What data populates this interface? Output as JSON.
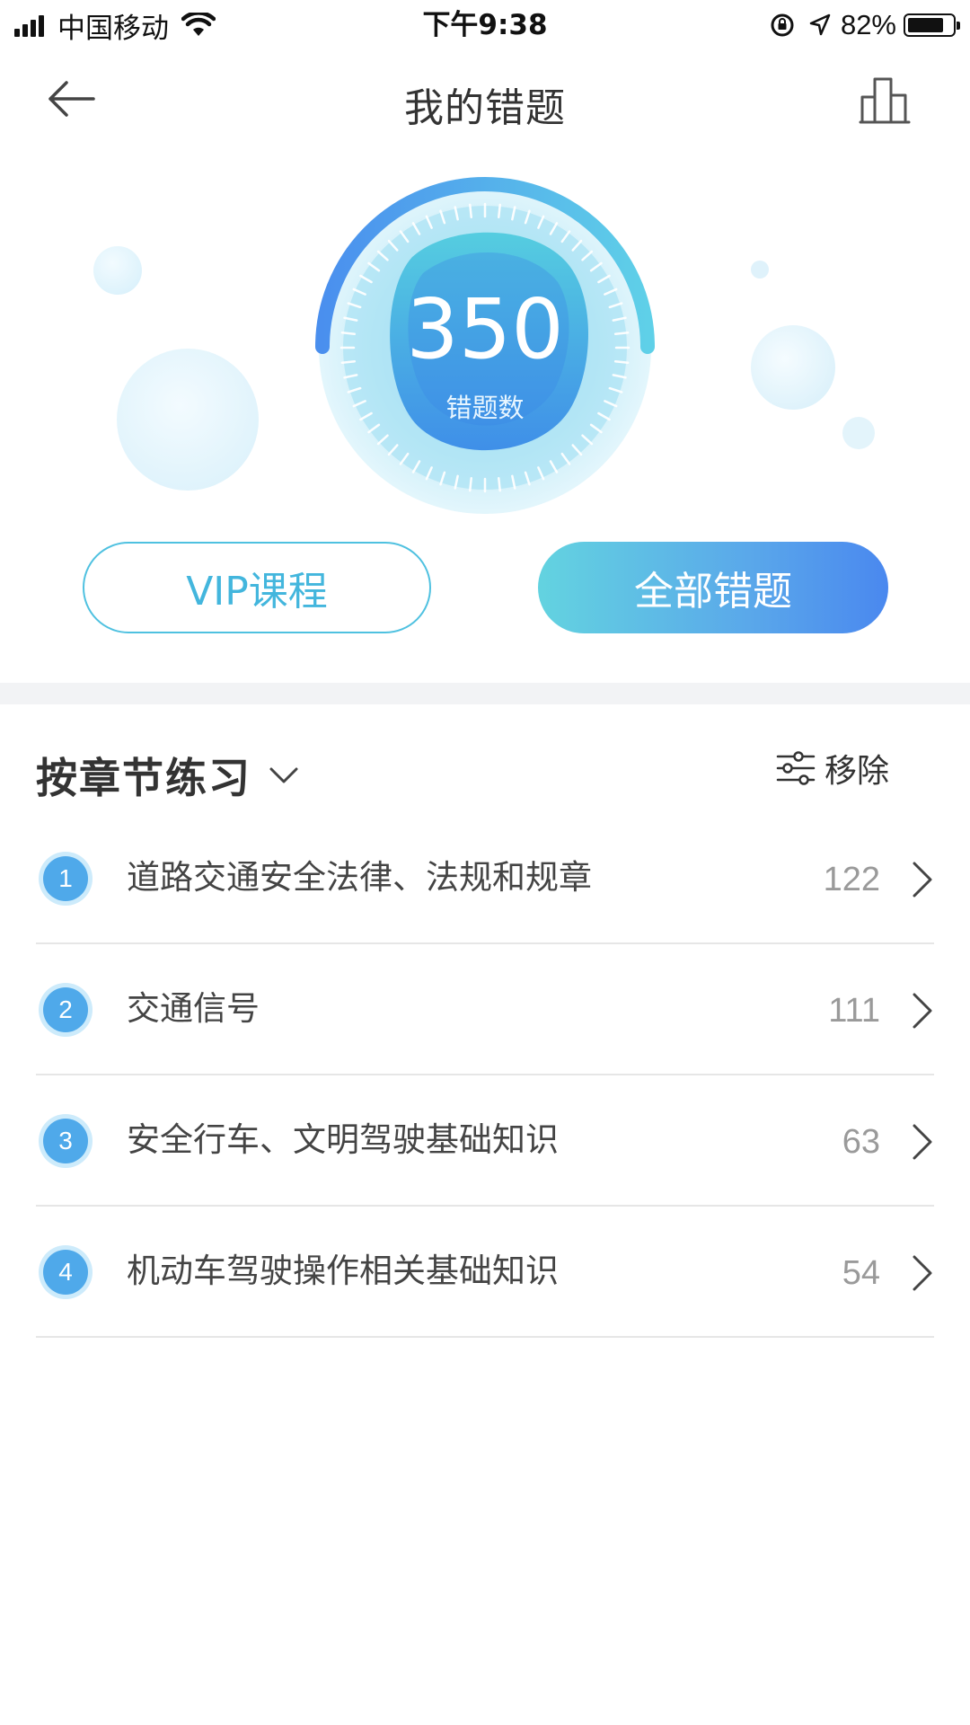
{
  "status_bar": {
    "carrier": "中国移动",
    "time": "下午9:38",
    "battery": "82%",
    "battery_level": 0.82
  },
  "nav": {
    "title": "我的错题",
    "back_icon": "arrow-left-icon",
    "stats_icon": "bar-chart-icon"
  },
  "summary": {
    "count": "350",
    "count_label": "错题数"
  },
  "actions": {
    "vip": "VIP课程",
    "all_wrong": "全部错题"
  },
  "section": {
    "title": "按章节练习",
    "remove_label": "移除"
  },
  "chapters": [
    {
      "num": "1",
      "title": "道路交通安全法律、法规和规章",
      "count": "122"
    },
    {
      "num": "2",
      "title": "交通信号",
      "count": "111"
    },
    {
      "num": "3",
      "title": "安全行车、文明驾驶基础知识",
      "count": "63"
    },
    {
      "num": "4",
      "title": "机动车驾驶操作相关基础知识",
      "count": "54"
    }
  ],
  "colors": {
    "accent_blue": "#4a88ef",
    "accent_cyan": "#63d3e0",
    "vip_border": "#4fc1e0"
  }
}
